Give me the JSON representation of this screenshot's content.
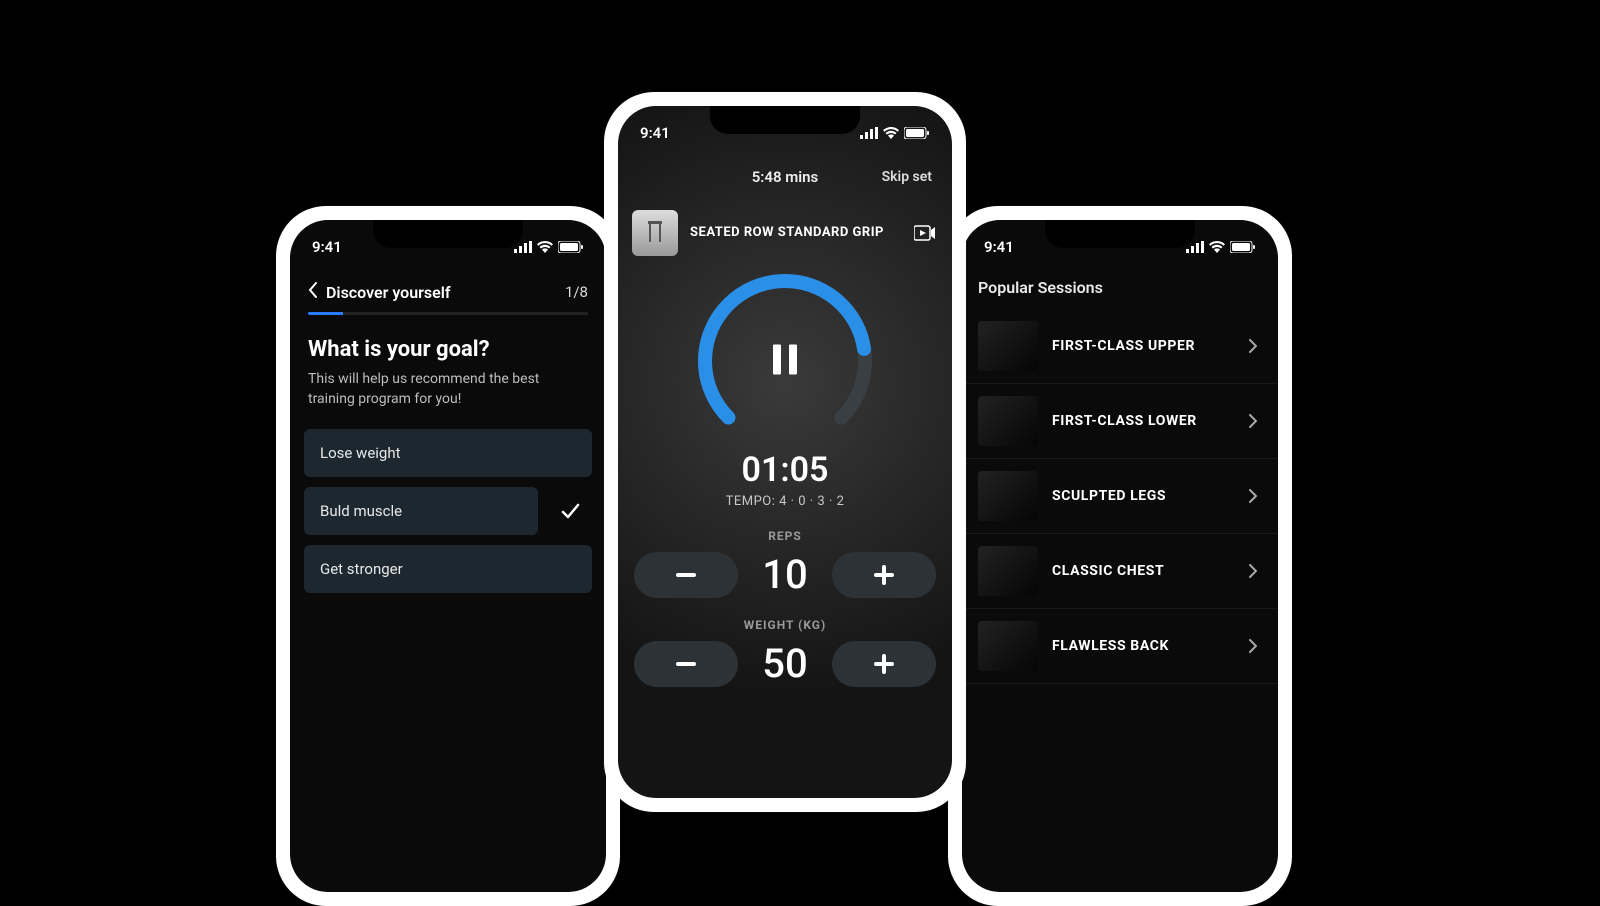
{
  "status_time": "9:41",
  "left": {
    "nav_title": "Discover yourself",
    "step_indicator": "1/8",
    "heading": "What is your goal?",
    "subheading": "This will help us recommend the best training program for you!",
    "options": [
      {
        "label": "Lose weight",
        "selected": false
      },
      {
        "label": "Buld muscle",
        "selected": true
      },
      {
        "label": "Get stronger",
        "selected": false
      }
    ]
  },
  "center": {
    "elapsed": "5:48 mins",
    "skip_label": "Skip set",
    "exercise_name": "SEATED ROW STANDARD GRIP",
    "countdown": "01:05",
    "tempo_label": "TEMPO: 4 · 0 · 3 · 2",
    "reps_label": "REPS",
    "reps_value": "10",
    "weight_label": "WEIGHT (KG)",
    "weight_value": "50",
    "progress_percent": 80
  },
  "right": {
    "section_title": "Popular Sessions",
    "sessions": [
      {
        "title": "FIRST-CLASS UPPER"
      },
      {
        "title": "FIRST-CLASS LOWER"
      },
      {
        "title": "SCULPTED LEGS"
      },
      {
        "title": "CLASSIC CHEST"
      },
      {
        "title": "FLAWLESS BACK"
      }
    ]
  }
}
